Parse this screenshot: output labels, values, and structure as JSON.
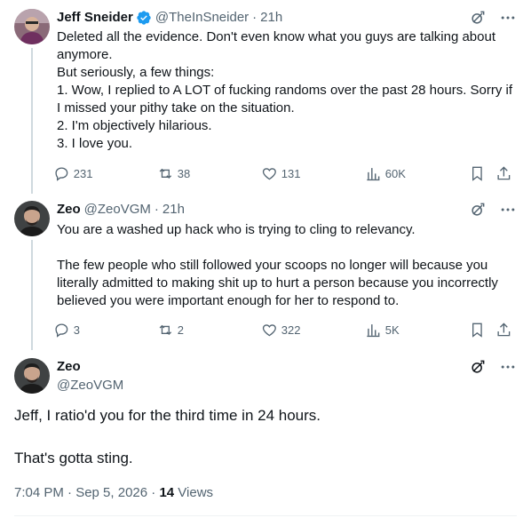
{
  "tweets": [
    {
      "name": "Jeff Sneider",
      "handle": "@TheInSneider",
      "time": "21h",
      "verified": true,
      "text": "Deleted all the evidence. Don't even know what you guys are talking about anymore.\nBut seriously, a few things:\n1. Wow, I replied to A LOT of fucking randoms over the past 28 hours. Sorry if I missed your pithy take on the situation.\n2. I'm objectively hilarious.\n3. I love you.",
      "replies": "231",
      "reposts": "38",
      "likes": "131",
      "views": "60K"
    },
    {
      "name": "Zeo",
      "handle": "@ZeoVGM",
      "time": "21h",
      "verified": false,
      "text": "You are a washed up hack who is trying to cling to relevancy.\n\nThe few people who still followed your scoops no longer will because you literally admitted to making shit up to hurt a person because you incorrectly believed you were important enough for her to respond to.",
      "replies": "3",
      "reposts": "2",
      "likes": "322",
      "views": "5K"
    }
  ],
  "main_tweet": {
    "name": "Zeo",
    "handle": "@ZeoVGM",
    "text": "Jeff, I ratio'd you for the third time in 24 hours.\n\nThat's gotta sting.",
    "timestamp": "7:04 PM · Sep 5, 2026 · ",
    "views_count": "14",
    "views_label": " Views"
  },
  "separator": "·",
  "colors": {
    "text": "#0f1419",
    "secondary": "#536471",
    "verified": "#1d9bf0",
    "thread_line": "#cfd9de"
  }
}
